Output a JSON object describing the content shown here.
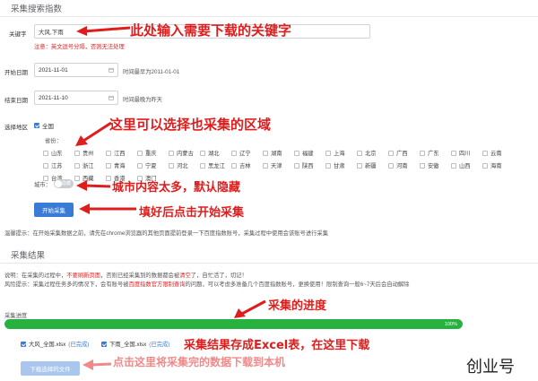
{
  "section1_title": "采集搜索指数",
  "keyword": {
    "label": "关键字",
    "value": "大风,下雨",
    "note": "注意：英文逗号分隔，否则无法处理"
  },
  "start_date": {
    "label": "开始日期",
    "value": "2021-11-01",
    "hint": "时间最早为2011-01-01"
  },
  "end_date": {
    "label": "结束日期",
    "value": "2021-11-10",
    "hint": "时间最晚为昨天"
  },
  "region": {
    "label": "选择地区",
    "all_label": "全国",
    "all_checked": true,
    "province_label": "省份：",
    "provinces": [
      "山东",
      "贵州",
      "江西",
      "重庆",
      "内蒙古",
      "湖北",
      "辽宁",
      "湖南",
      "福建",
      "上海",
      "北京",
      "广西",
      "广东",
      "四川",
      "云南",
      "江苏",
      "浙江",
      "青海",
      "宁夏",
      "河北",
      "黑龙江",
      "吉林",
      "天津",
      "陕西",
      "甘肃",
      "新疆",
      "河南",
      "安徽",
      "山西",
      "海南",
      "台湾",
      "西藏",
      "香港",
      "澳门"
    ],
    "city_label": "城市：",
    "city_switch_text": "隐藏"
  },
  "start_button": "开始采集",
  "tip_text": "温馨提示：在开始采集数据之前，请先在chrome浏览器的其他页面提前登录一下百度指数账号，采集过程中使用会该账号进行采集",
  "section2_title": "采集结果",
  "explain": {
    "prefix": "说明：在采集的过程中，",
    "highlight1": "不要刷新页面",
    "mid": "，否则已经采集到的数据都会被",
    "highlight2": "清空",
    "suffix": "了，自忙活了，切记！"
  },
  "risk": {
    "prefix": "风险提示：采集过程任务多的情况下，会有账号被",
    "highlight": "百度指数官方限制查询",
    "suffix": "的问题，可以考虑多准备几个百度指数账号，更换使用！限制查询一般6~7天后会自动解除"
  },
  "progress": {
    "label": "采集进度",
    "percent_text": "100%",
    "value": 1.0
  },
  "files": [
    {
      "name": "大风_全国.xlsx",
      "status": "(已完成)",
      "checked": true
    },
    {
      "name": "下雨_全国.xlsx",
      "status": "(已完成)",
      "checked": true
    }
  ],
  "download_button": "下载选择的文件",
  "annotations": {
    "a1": "此处输入需要下载的关键字",
    "a2": "这里可以选择也采集的区域",
    "a3": "城市内容太多，默认隐藏",
    "a4": "填好后点击开始采集",
    "a5": "采集的进度",
    "a6": "采集结果存成Excel表，在这里下载",
    "a7": "点击这里将采集完的数据下载到本机"
  },
  "watermark": "创业号",
  "colors": {
    "primary": "#3a7bd5",
    "annotation_red": "#e01d1d",
    "progress_green": "#27b13e"
  }
}
